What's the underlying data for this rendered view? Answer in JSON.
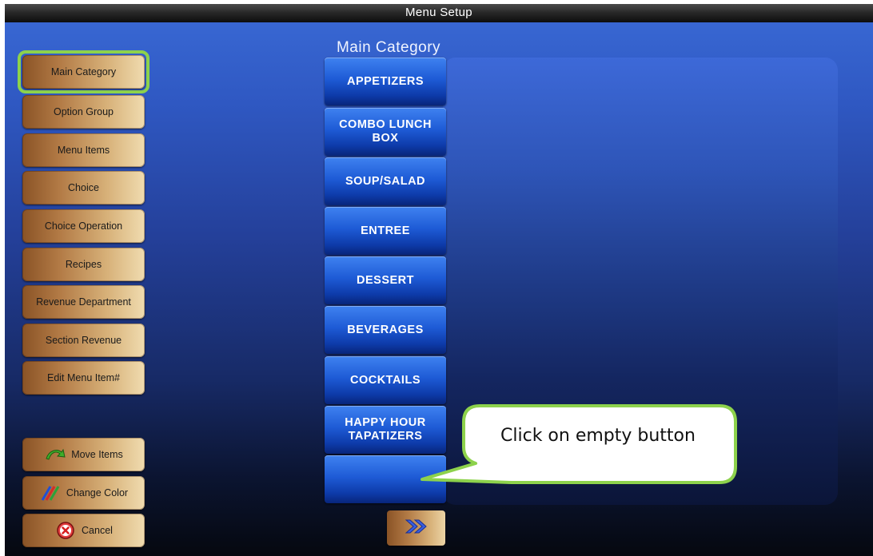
{
  "window": {
    "title": "Menu Setup"
  },
  "section_title": "Main Category",
  "sidebar": {
    "items": [
      {
        "label": "Main Category"
      },
      {
        "label": "Option Group"
      },
      {
        "label": "Menu Items"
      },
      {
        "label": "Choice"
      },
      {
        "label": "Choice Operation"
      },
      {
        "label": "Recipes"
      },
      {
        "label": "Revenue Department"
      },
      {
        "label": "Section Revenue"
      },
      {
        "label": "Edit Menu Item#"
      }
    ],
    "selected": "Main Category"
  },
  "actions": {
    "move_items": "Move Items",
    "change_color": "Change Color",
    "cancel": "Cancel"
  },
  "categories": [
    {
      "label": "APPETIZERS"
    },
    {
      "label": "COMBO LUNCH BOX"
    },
    {
      "label": "SOUP/SALAD"
    },
    {
      "label": "ENTREE"
    },
    {
      "label": "DESSERT"
    },
    {
      "label": "BEVERAGES"
    },
    {
      "label": "COCKTAILS"
    },
    {
      "label": "HAPPY HOUR TAPATIZERS"
    },
    {
      "label": ""
    }
  ],
  "callout": {
    "text": "Click on empty button"
  },
  "icons": {
    "move": "green-arrow-icon",
    "color": "color-pencils-icon",
    "cancel": "red-x-icon",
    "next": "double-chevron-right-icon"
  },
  "colors": {
    "callout_border": "#8dd24c",
    "selection_border": "#8dd24c",
    "category_blue": "#1e5bd6",
    "gold_button": "#d8b27a"
  }
}
